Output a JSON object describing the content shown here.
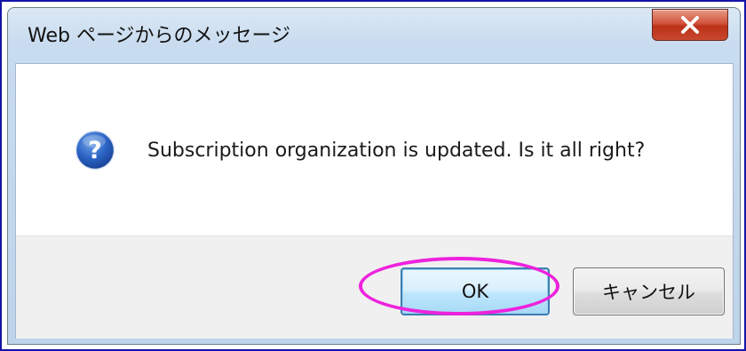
{
  "dialog": {
    "title": "Web ページからのメッセージ",
    "message": "Subscription organization is updated. Is it all right?",
    "icon": "question-icon"
  },
  "buttons": {
    "ok_label": "OK",
    "cancel_label": "キャンセル"
  },
  "colors": {
    "annotation_outline": "#ee22dd",
    "close_button": "#c9492e",
    "ok_button_border": "#3c7fb1"
  }
}
